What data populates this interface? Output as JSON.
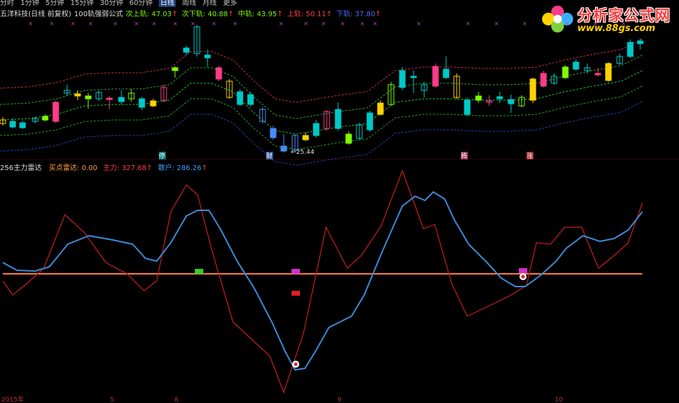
{
  "toolbar": {
    "tabs": [
      "分时",
      "1分钟",
      "5分钟",
      "15分钟",
      "30分钟",
      "60分钟",
      "日线",
      "周线",
      "月线",
      "更多"
    ],
    "active": "日线"
  },
  "header": {
    "stock": "五洋科技(日线 前复权)",
    "formula": "100轨强弱公式",
    "lines": [
      {
        "label": "次上轨:",
        "value": "47.03",
        "arrow": "↑",
        "color": "#7cfc00"
      },
      {
        "label": "次下轨:",
        "value": "40.88",
        "arrow": "↑",
        "color": "#7cfc00"
      },
      {
        "label": "中轨:",
        "value": "43.95",
        "arrow": "↑",
        "color": "#7cfc00"
      },
      {
        "label": "上轨:",
        "value": "50.11",
        "arrow": "↑",
        "color": "#ff4040"
      },
      {
        "label": "下轨:",
        "value": "37.80",
        "arrow": "↑",
        "color": "#4a6cff"
      }
    ]
  },
  "indicator": {
    "name": "256主力雷达",
    "items": [
      {
        "label": "买点雷达:",
        "value": "0.00",
        "arrow": "",
        "color": "#ff9a3c"
      },
      {
        "label": "主力:",
        "value": "327.68",
        "arrow": "↑",
        "color": "#ff3b3b"
      },
      {
        "label": "散户:",
        "value": "286.26",
        "arrow": "↑",
        "color": "#3c9cff"
      }
    ]
  },
  "annotations": {
    "low_price": "25.44",
    "marks": [
      "停",
      "财",
      "腾",
      "涨"
    ]
  },
  "xaxis": [
    "2015年",
    "5",
    "8",
    "9",
    "10"
  ],
  "logo": {
    "title": "分析家公式网",
    "url": "www.88gs.com"
  },
  "colors": {
    "up": "#ff3b3b",
    "down": "#00c0c0",
    "mid": "#00c000",
    "upper": "#c83030",
    "lower": "#2040a0",
    "zero": "#ff7a3c",
    "main": "#c81e1e",
    "retail": "#3c8ad8"
  }
}
